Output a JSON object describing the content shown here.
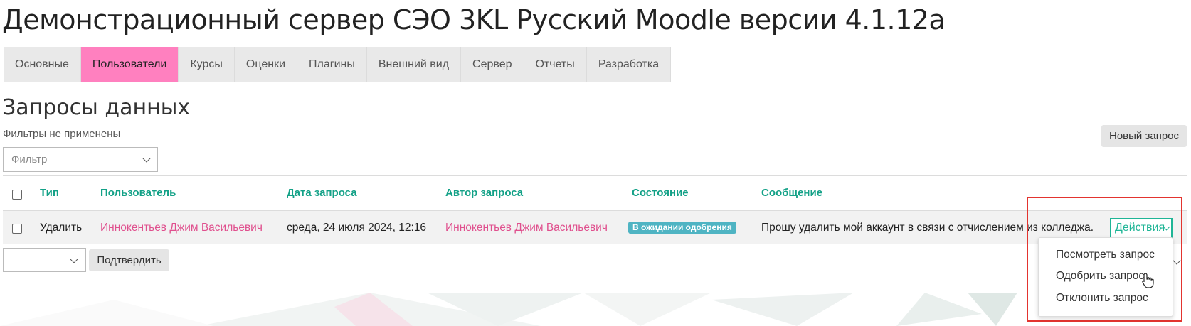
{
  "header": {
    "title": "Демонстрационный сервер СЭО 3KL Русский Moodle версии 4.1.12a"
  },
  "tabs": [
    {
      "label": "Основные",
      "active": false
    },
    {
      "label": "Пользователи",
      "active": true
    },
    {
      "label": "Курсы",
      "active": false
    },
    {
      "label": "Оценки",
      "active": false
    },
    {
      "label": "Плагины",
      "active": false
    },
    {
      "label": "Внешний вид",
      "active": false
    },
    {
      "label": "Сервер",
      "active": false
    },
    {
      "label": "Отчеты",
      "active": false
    },
    {
      "label": "Разработка",
      "active": false
    }
  ],
  "main": {
    "heading": "Запросы данных",
    "filters_note": "Фильтры не применены",
    "filter_placeholder": "Фильтр",
    "new_request_label": "Новый запрос",
    "confirm_label": "Подтвердить"
  },
  "table": {
    "columns": [
      "Тип",
      "Пользователь",
      "Дата запроса",
      "Автор запроса",
      "Состояние",
      "Сообщение"
    ],
    "rows": [
      {
        "type": "Удалить",
        "user": "Иннокентьев Джим Васильевич",
        "date": "среда, 24 июля 2024, 12:16",
        "author": "Иннокентьев Джим Васильевич",
        "status": "В ожидании одобрения",
        "message": "Прошу удалить мой аккаунт в связи с отчислением из колледжа.",
        "actions_label": "Действия"
      }
    ]
  },
  "actions_menu": {
    "items": [
      "Посмотреть запрос",
      "Одобрить запрос",
      "Отклонить запрос"
    ]
  },
  "colors": {
    "accent": "#13a187",
    "active_tab": "#ff80bf",
    "link": "#e0508e",
    "badge": "#4fb4c3",
    "highlight_box": "#e3342f"
  }
}
